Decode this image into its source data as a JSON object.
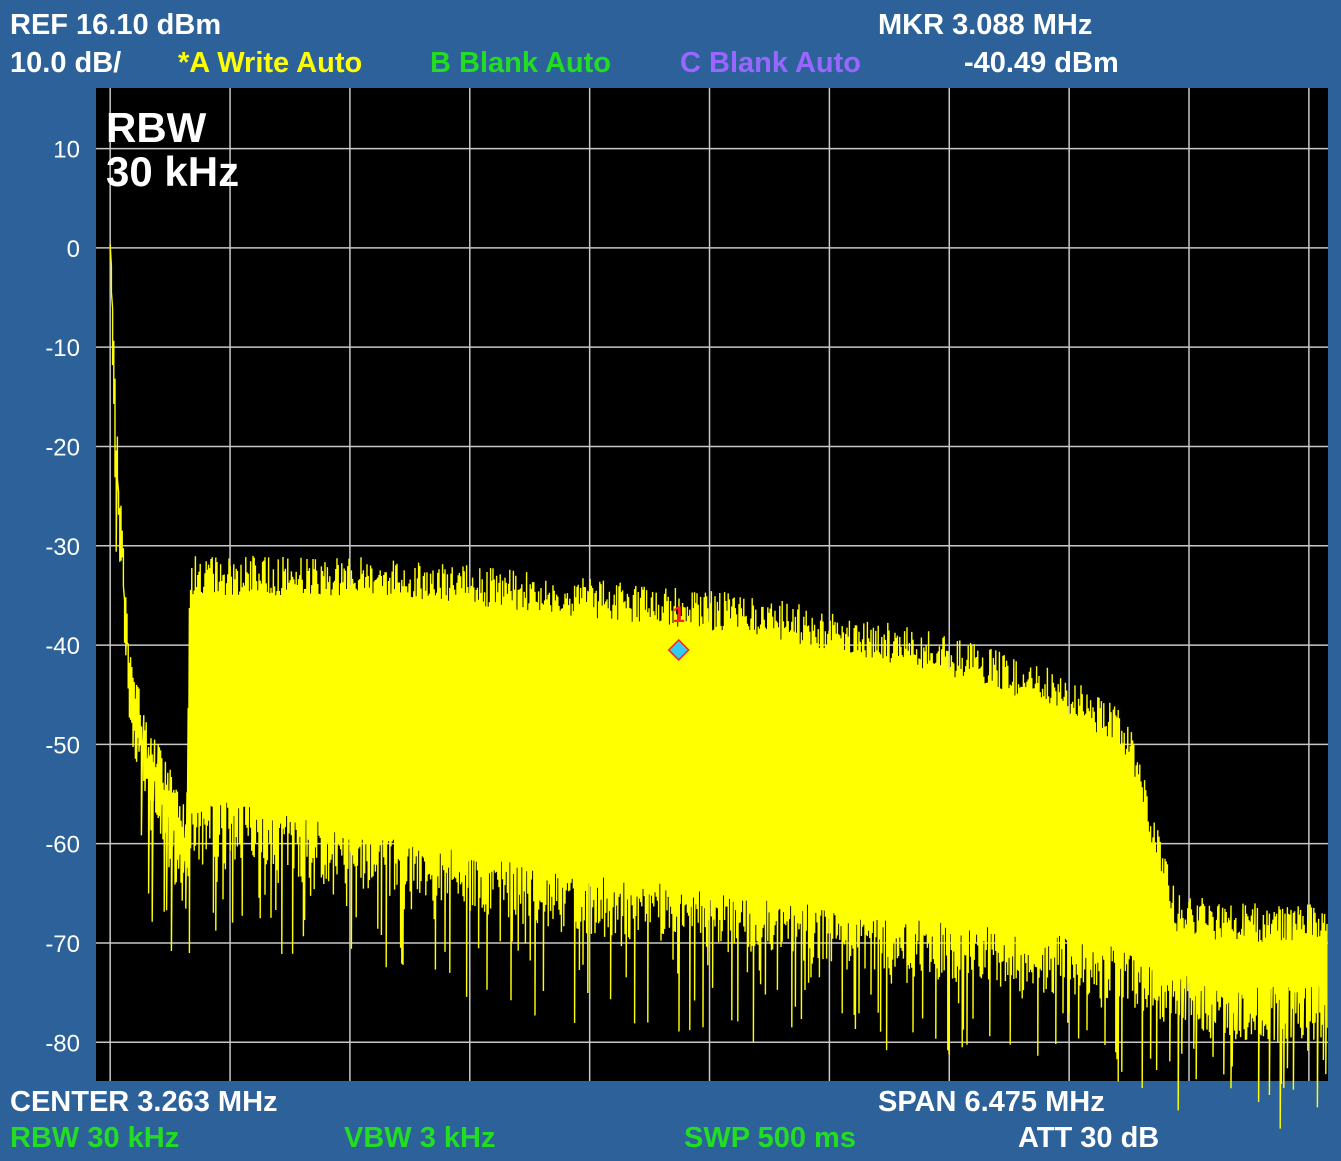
{
  "header": {
    "ref": "REF  16.10 dBm",
    "scale": "10.0 dB/",
    "trace_a": "*A Write Auto",
    "trace_b": "B Blank Auto",
    "trace_c": "C Blank Auto",
    "marker_freq": "MKR 3.088 MHz",
    "marker_level": "-40.49 dBm"
  },
  "footer": {
    "center": "CENTER 3.263 MHz",
    "span": "SPAN 6.475 MHz",
    "rbw": "RBW  30 kHz",
    "vbw": "VBW  3 kHz",
    "sweep": "SWP  500 ms",
    "att": "ATT 30 dB"
  },
  "overlay": {
    "line1": "RBW",
    "line2": "30 kHz"
  },
  "marker": {
    "label": "1",
    "freq_mhz": 3.088,
    "level_dbm": -40.49
  },
  "colors": {
    "background": "#2c6299",
    "plot_bg": "#000000",
    "grid": "#c8c8c8",
    "trace": "#ffff00",
    "marker": "#33ccee",
    "marker_outline": "#ff2222"
  },
  "chart_data": {
    "type": "line",
    "title": "",
    "xlabel": "",
    "ylabel": "",
    "x_units": "MHz",
    "y_units": "dBm",
    "xlim": [
      0.0255,
      6.5005
    ],
    "ylim": [
      -83.9,
      16.1
    ],
    "ytick_labels": [
      "10",
      "0",
      "-10",
      "-20",
      "-30",
      "-40",
      "-50",
      "-60",
      "-70",
      "-80"
    ],
    "ytick_values": [
      10,
      0,
      -10,
      -20,
      -30,
      -40,
      -50,
      -60,
      -70,
      -80
    ],
    "grid": true,
    "series": [
      {
        "name": "*A Write Auto",
        "envelope_points": {
          "x": [
            0.1,
            0.13,
            0.2,
            0.3,
            0.45,
            0.5,
            0.52,
            1.0,
            1.5,
            2.0,
            2.5,
            3.0,
            3.5,
            4.0,
            4.5,
            5.0,
            5.4,
            5.5,
            5.6,
            5.7,
            6.0,
            6.5
          ],
          "peak": [
            0.0,
            -18.0,
            -42.0,
            -50.0,
            -55.0,
            -58.0,
            -33.0,
            -33.0,
            -33.0,
            -34.0,
            -35.0,
            -36.0,
            -37.0,
            -39.0,
            -41.0,
            -44.0,
            -48.0,
            -52.0,
            -60.0,
            -67.0,
            -68.0,
            -68.0
          ],
          "floor": [
            0.0,
            -22.0,
            -46.0,
            -55.0,
            -62.0,
            -64.0,
            -58.0,
            -60.0,
            -62.0,
            -64.0,
            -66.0,
            -67.0,
            -68.0,
            -70.0,
            -71.0,
            -72.0,
            -73.0,
            -74.0,
            -75.0,
            -76.0,
            -77.0,
            -77.0
          ]
        }
      }
    ]
  }
}
